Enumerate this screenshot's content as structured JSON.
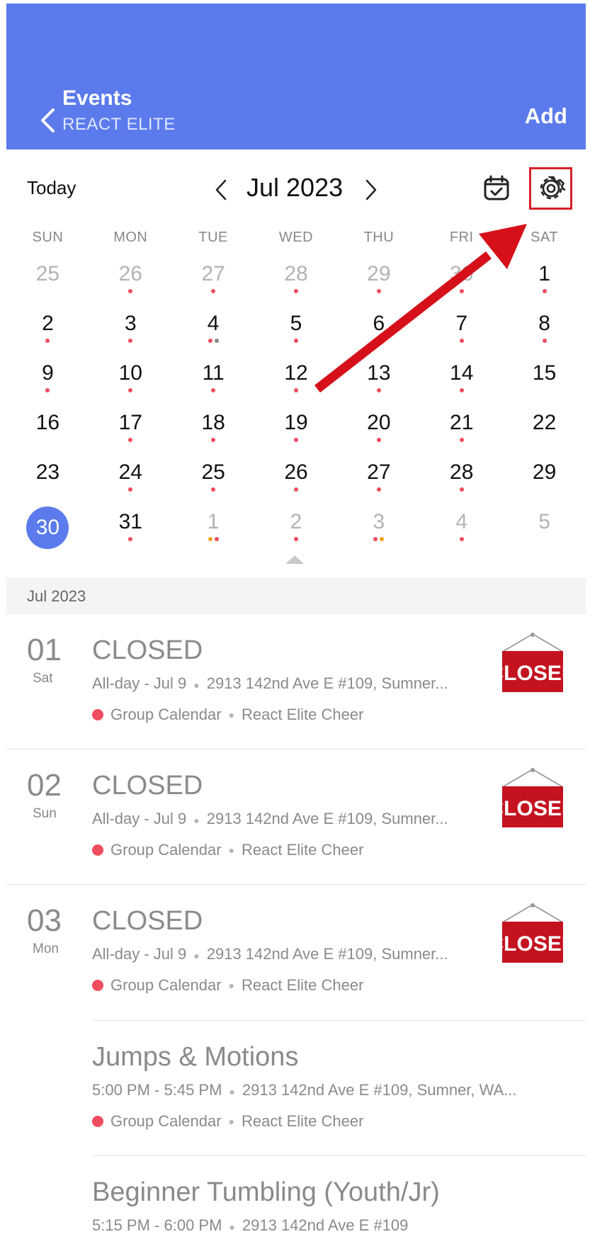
{
  "header": {
    "title": "Events",
    "subtitle": "REACT ELITE",
    "add_label": "Add",
    "color": "#5b7bec"
  },
  "toolbar": {
    "today_label": "Today",
    "month_label": "Jul 2023",
    "calendar_icon": "calendar-check-icon",
    "settings_icon": "gear-icon"
  },
  "weekdays": [
    "SUN",
    "MON",
    "TUE",
    "WED",
    "THU",
    "FRI",
    "SAT"
  ],
  "calendar": {
    "selected_day": "30",
    "weeks": [
      [
        {
          "d": "25",
          "other": true,
          "dots": []
        },
        {
          "d": "26",
          "other": true,
          "dots": [
            "red"
          ]
        },
        {
          "d": "27",
          "other": true,
          "dots": [
            "red"
          ]
        },
        {
          "d": "28",
          "other": true,
          "dots": [
            "red"
          ]
        },
        {
          "d": "29",
          "other": true,
          "dots": [
            "red"
          ]
        },
        {
          "d": "30",
          "other": true,
          "dots": [
            "red"
          ]
        },
        {
          "d": "1",
          "other": false,
          "dots": [
            "red"
          ]
        }
      ],
      [
        {
          "d": "2",
          "other": false,
          "dots": [
            "red"
          ]
        },
        {
          "d": "3",
          "other": false,
          "dots": [
            "red"
          ]
        },
        {
          "d": "4",
          "other": false,
          "dots": [
            "red",
            "gray"
          ]
        },
        {
          "d": "5",
          "other": false,
          "dots": [
            "red"
          ]
        },
        {
          "d": "6",
          "other": false,
          "dots": [
            "red"
          ]
        },
        {
          "d": "7",
          "other": false,
          "dots": [
            "red"
          ]
        },
        {
          "d": "8",
          "other": false,
          "dots": [
            "red"
          ]
        }
      ],
      [
        {
          "d": "9",
          "other": false,
          "dots": [
            "red"
          ]
        },
        {
          "d": "10",
          "other": false,
          "dots": [
            "red"
          ]
        },
        {
          "d": "11",
          "other": false,
          "dots": [
            "red"
          ]
        },
        {
          "d": "12",
          "other": false,
          "dots": [
            "red"
          ]
        },
        {
          "d": "13",
          "other": false,
          "dots": [
            "red"
          ]
        },
        {
          "d": "14",
          "other": false,
          "dots": [
            "red"
          ]
        },
        {
          "d": "15",
          "other": false,
          "dots": []
        }
      ],
      [
        {
          "d": "16",
          "other": false,
          "dots": []
        },
        {
          "d": "17",
          "other": false,
          "dots": [
            "red"
          ]
        },
        {
          "d": "18",
          "other": false,
          "dots": [
            "red"
          ]
        },
        {
          "d": "19",
          "other": false,
          "dots": [
            "red"
          ]
        },
        {
          "d": "20",
          "other": false,
          "dots": [
            "red"
          ]
        },
        {
          "d": "21",
          "other": false,
          "dots": [
            "red"
          ]
        },
        {
          "d": "22",
          "other": false,
          "dots": []
        }
      ],
      [
        {
          "d": "23",
          "other": false,
          "dots": []
        },
        {
          "d": "24",
          "other": false,
          "dots": [
            "red"
          ]
        },
        {
          "d": "25",
          "other": false,
          "dots": [
            "red"
          ]
        },
        {
          "d": "26",
          "other": false,
          "dots": [
            "red"
          ]
        },
        {
          "d": "27",
          "other": false,
          "dots": [
            "red"
          ]
        },
        {
          "d": "28",
          "other": false,
          "dots": [
            "red"
          ]
        },
        {
          "d": "29",
          "other": false,
          "dots": []
        }
      ],
      [
        {
          "d": "30",
          "other": false,
          "dots": [],
          "selected": true
        },
        {
          "d": "31",
          "other": false,
          "dots": [
            "red"
          ]
        },
        {
          "d": "1",
          "other": true,
          "dots": [
            "orange",
            "red"
          ]
        },
        {
          "d": "2",
          "other": true,
          "dots": [
            "red"
          ]
        },
        {
          "d": "3",
          "other": true,
          "dots": [
            "red",
            "orange"
          ]
        },
        {
          "d": "4",
          "other": true,
          "dots": [
            "red"
          ]
        },
        {
          "d": "5",
          "other": true,
          "dots": []
        }
      ]
    ]
  },
  "list": {
    "section_label": "Jul 2023",
    "events": [
      {
        "day": "01",
        "dow": "Sat",
        "title": "CLOSED",
        "time": "All-day - Jul 9",
        "location": "2913 142nd Ave E #109, Sumner...",
        "calendar": "Group Calendar",
        "owner": "React Elite Cheer",
        "image_text": "CLOSED"
      },
      {
        "day": "02",
        "dow": "Sun",
        "title": "CLOSED",
        "time": "All-day - Jul 9",
        "location": "2913 142nd Ave E #109, Sumner...",
        "calendar": "Group Calendar",
        "owner": "React Elite Cheer",
        "image_text": "CLOSED"
      },
      {
        "day": "03",
        "dow": "Mon",
        "title": "CLOSED",
        "time": "All-day - Jul 9",
        "location": "2913 142nd Ave E #109, Sumner...",
        "calendar": "Group Calendar",
        "owner": "React Elite Cheer",
        "image_text": "CLOSED"
      },
      {
        "title": "Jumps & Motions",
        "time": "5:00 PM - 5:45 PM",
        "location": "2913 142nd Ave E #109, Sumner, WA...",
        "calendar": "Group Calendar",
        "owner": "React Elite Cheer"
      },
      {
        "title": "Beginner Tumbling (Youth/Jr)",
        "time": "5:15 PM - 6:00 PM",
        "location": "2913 142nd Ave E #109"
      }
    ]
  },
  "colors": {
    "accent": "#5b7bec",
    "event_dot": "#ef4d5f",
    "annotation": "#d6202a"
  }
}
